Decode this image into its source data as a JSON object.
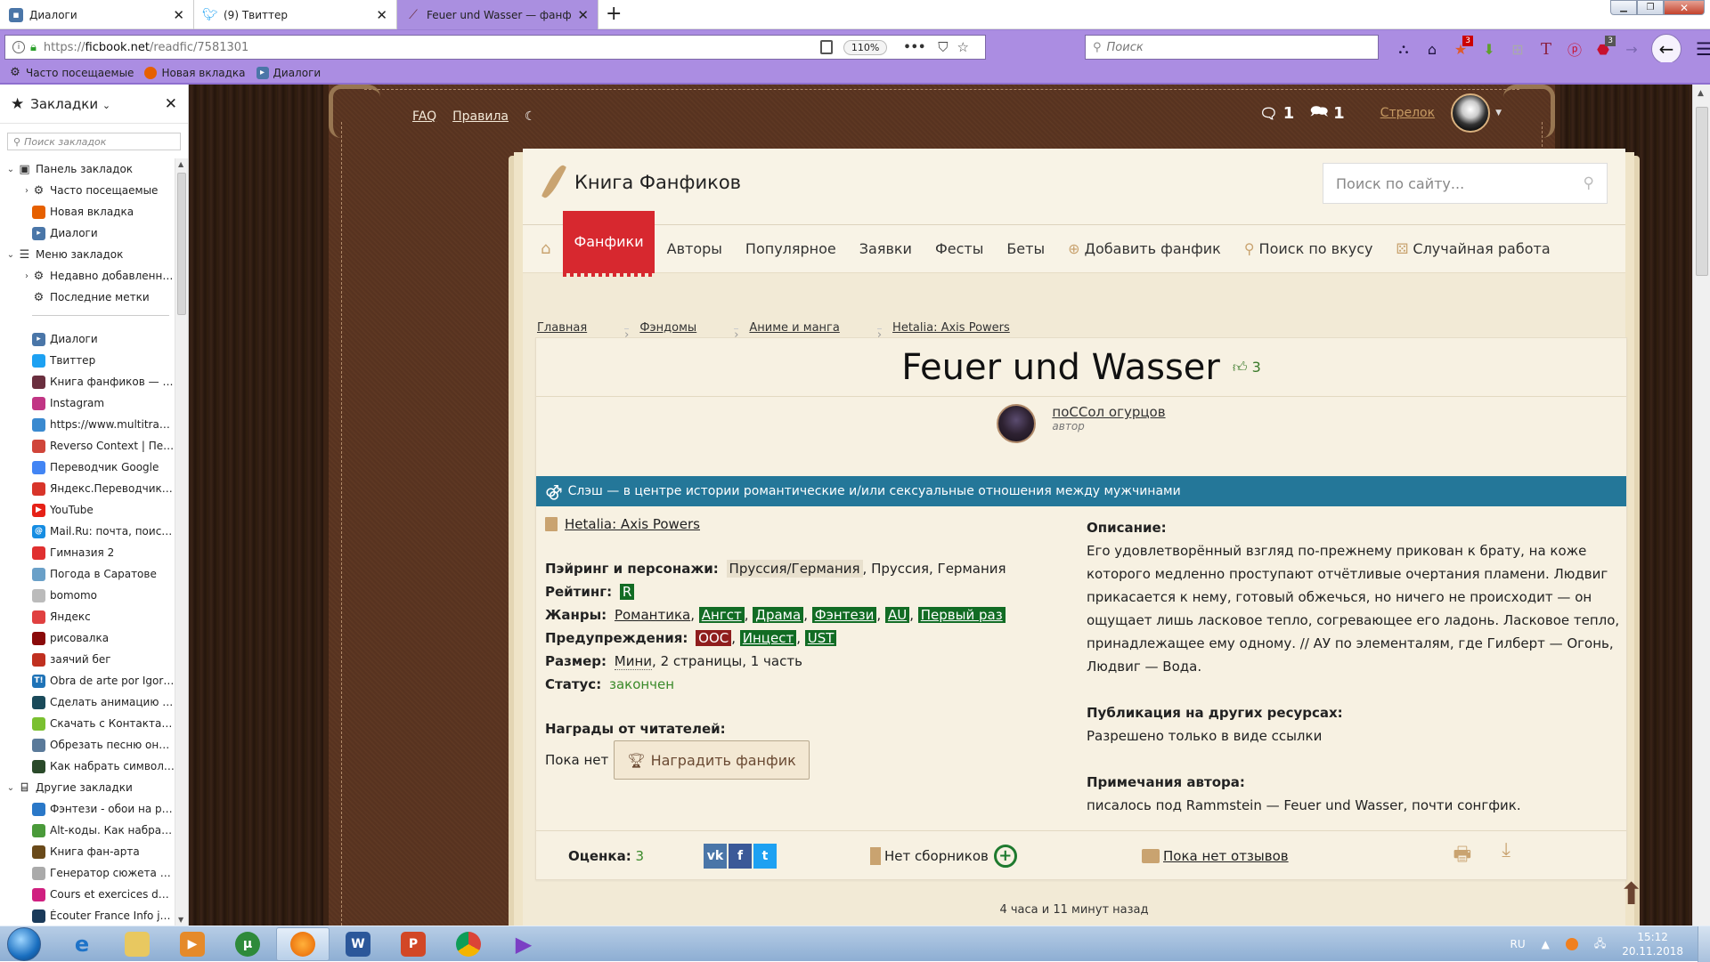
{
  "browser": {
    "tabs": [
      {
        "label": "Диалоги",
        "icon": "dialogs-icon",
        "active": false
      },
      {
        "label": "(9) Твиттер",
        "icon": "twitter-icon",
        "active": false
      },
      {
        "label": "Feuer und Wasser — фанфик п",
        "icon": "feather-icon",
        "active": true
      }
    ],
    "new_tab": "+",
    "url_prefix": "https://",
    "url_domain": "ficbook.net",
    "url_path": "/readfic/7581301",
    "zoom": "110%",
    "search_placeholder": "Поиск",
    "badges": {
      "ext1": "3",
      "abp": "3"
    },
    "bookmarks_toolbar": [
      {
        "label": "Часто посещаемые",
        "icon": "gear-icon"
      },
      {
        "label": "Новая вкладка",
        "icon": "firefox-icon"
      },
      {
        "label": "Диалоги",
        "icon": "dialogs-icon"
      }
    ]
  },
  "sidebar": {
    "title": "Закладки",
    "search_placeholder": "Поиск закладок",
    "tree": [
      {
        "label": "Панель закладок",
        "level": 0,
        "twisty": "open",
        "icon": "bookmarks-toolbar-icon"
      },
      {
        "label": "Часто посещаемые",
        "level": 1,
        "twisty": "closed",
        "icon": "gear-icon"
      },
      {
        "label": "Новая вкладка",
        "level": 1,
        "icon": "firefox-icon"
      },
      {
        "label": "Диалоги",
        "level": 1,
        "icon": "dialogs-icon"
      },
      {
        "label": "Меню закладок",
        "level": 0,
        "twisty": "open",
        "icon": "menu-icon"
      },
      {
        "label": "Недавно добавленные",
        "level": 1,
        "twisty": "closed",
        "icon": "gear-icon"
      },
      {
        "label": "Последние метки",
        "level": 1,
        "icon": "gear-icon"
      },
      {
        "separator": true
      },
      {
        "label": "Диалоги",
        "level": 1,
        "icon": "dialogs-icon"
      },
      {
        "label": "Твиттер",
        "level": 1,
        "icon": "twitter-icon"
      },
      {
        "label": "Книга фанфиков — пр...",
        "level": 1,
        "icon": "feather-icon"
      },
      {
        "label": "Instagram",
        "level": 1,
        "icon": "instagram-icon"
      },
      {
        "label": "https://www.multitran....",
        "level": 1,
        "icon": "multitran-icon"
      },
      {
        "label": "Reverso Context | Пере...",
        "level": 1,
        "icon": "reverso-icon"
      },
      {
        "label": "Переводчик Google",
        "level": 1,
        "icon": "google-translate-icon"
      },
      {
        "label": "Яндекс.Переводчик – ...",
        "level": 1,
        "icon": "yandex-translate-icon"
      },
      {
        "label": "YouTube",
        "level": 1,
        "icon": "youtube-icon"
      },
      {
        "label": "Mail.Ru: почта, поиск ...",
        "level": 1,
        "icon": "mailru-icon"
      },
      {
        "label": "Гимназия 2",
        "level": 1,
        "icon": "school-icon"
      },
      {
        "label": "Погода в Саратове",
        "level": 1,
        "icon": "weather-icon"
      },
      {
        "label": "bomomo",
        "level": 1,
        "icon": "bomomo-icon"
      },
      {
        "label": "Яндекс",
        "level": 1,
        "icon": "yandex-icon"
      },
      {
        "label": "рисовалка",
        "level": 1,
        "icon": "draw-icon"
      },
      {
        "label": "заячий бег",
        "level": 1,
        "icon": "apple-icon"
      },
      {
        "label": "Obra de arte por Igor Ki...",
        "level": 1,
        "icon": "tumblr-icon"
      },
      {
        "label": "Сделать анимацию он...",
        "level": 1,
        "icon": "spiral-icon"
      },
      {
        "label": "Скачать с Контакта, Ю...",
        "level": 1,
        "icon": "download-icon"
      },
      {
        "label": "Обрезать песню онла...",
        "level": 1,
        "icon": "mp3-icon"
      },
      {
        "label": "Как набрать символы ...",
        "level": 1,
        "icon": "keyboard-icon"
      },
      {
        "label": "Другие закладки",
        "level": 0,
        "twisty": "open",
        "icon": "folder-icon"
      },
      {
        "label": "Фэнтези - обои на раб...",
        "level": 1,
        "icon": "monitor-icon"
      },
      {
        "label": "Alt-коды. Как набрать ...",
        "level": 1,
        "icon": "altcode-icon"
      },
      {
        "label": "Книга фан-арта",
        "level": 1,
        "icon": "fanart-icon"
      },
      {
        "label": "Генератор сюжета рас...",
        "level": 1,
        "icon": "generator-icon"
      },
      {
        "label": "Cours et exercices de fr...",
        "level": 1,
        "icon": "colors-icon"
      },
      {
        "label": "Écouter France Info jun...",
        "level": 1,
        "icon": "radio-icon"
      }
    ]
  },
  "site": {
    "top_links": [
      "FAQ",
      "Правила"
    ],
    "messages_count": "1",
    "dialogs_count": "1",
    "username": "Стрелок",
    "logo_text": "Книга Фанфиков",
    "search_placeholder": "Поиск по сайту...",
    "nav": {
      "active": "Фанфики",
      "items": [
        "Авторы",
        "Популярное",
        "Заявки",
        "Фесты",
        "Беты"
      ],
      "actions": [
        "Добавить фанфик",
        "Поиск по вкусу",
        "Случайная работа"
      ]
    },
    "breadcrumb": [
      "Главная",
      "Фэндомы",
      "Аниме и манга",
      "Hetalia: Axis Powers"
    ]
  },
  "fic": {
    "title": "Feuer und Wasser",
    "likes": "3",
    "author": "поССол огурцов",
    "author_role": "автор",
    "direction_note": "Слэш — в центре истории романтические и/или сексуальные отношения между мужчинами",
    "fandom": "Hetalia: Axis Powers",
    "labels": {
      "pairing": "Пэйринг и персонажи:",
      "rating": "Рейтинг:",
      "genres": "Жанры:",
      "warnings": "Предупреждения:",
      "size": "Размер:",
      "status": "Статус:",
      "awards": "Награды от читателей:",
      "description": "Описание:",
      "publication": "Публикация на других ресурсах:",
      "notes": "Примечания автора:",
      "score": "Оценка:"
    },
    "pairing_main": "Пруссия/Германия",
    "pairing_rest": ", Пруссия, Германия",
    "rating": "R",
    "genres": [
      {
        "label": "Романтика",
        "style": "plain"
      },
      {
        "label": "Ангст",
        "style": "green"
      },
      {
        "label": "Драма",
        "style": "green"
      },
      {
        "label": "Фэнтези",
        "style": "green"
      },
      {
        "label": "AU",
        "style": "green"
      },
      {
        "label": "Первый раз",
        "style": "green"
      }
    ],
    "warnings": [
      {
        "label": "OOC",
        "style": "red"
      },
      {
        "label": "Инцест",
        "style": "green"
      },
      {
        "label": "UST",
        "style": "green"
      }
    ],
    "size_link": "Мини",
    "size_rest": ", 2 страницы, 1 часть",
    "status": "закончен",
    "awards_none": "Пока нет",
    "award_button": "Наградить фанфик",
    "description": "Его удовлетворённый взгляд по-прежнему прикован к брату, на коже которого медленно проступают отчётливые очертания пламени. Людвиг прикасается к нему, готовый обжечься, но ничего не происходит — он ощущает лишь ласковое тепло, согревающее его ладонь. Ласковое тепло, принадлежащее ему одному. // АУ по элементалям, где Гилберт — Огонь, Людвиг — Вода.",
    "publication": "Разрешено только в виде ссылки",
    "notes": "писалось под Rammstein — Feuer und Wasser, почти сонгфик.",
    "score": "3",
    "collections": "Нет сборников",
    "reviews": "Пока нет отзывов",
    "published_ago": "4 часа и 11 минут назад"
  },
  "taskbar": {
    "apps": [
      "start",
      "internet-explorer",
      "explorer",
      "media-player",
      "utorrent",
      "firefox",
      "word",
      "powerpoint",
      "chrome",
      "visual-studio"
    ],
    "active_app": "firefox",
    "lang": "RU",
    "time": "15:12",
    "date": "20.11.2018"
  },
  "colors": {
    "browser_accent": "#ab8de2",
    "nav_active": "#d7282f",
    "slash_bar": "#247799",
    "tag_green": "#126c24",
    "tag_red": "#8f1d1d",
    "status_green": "#3a8a2a"
  }
}
